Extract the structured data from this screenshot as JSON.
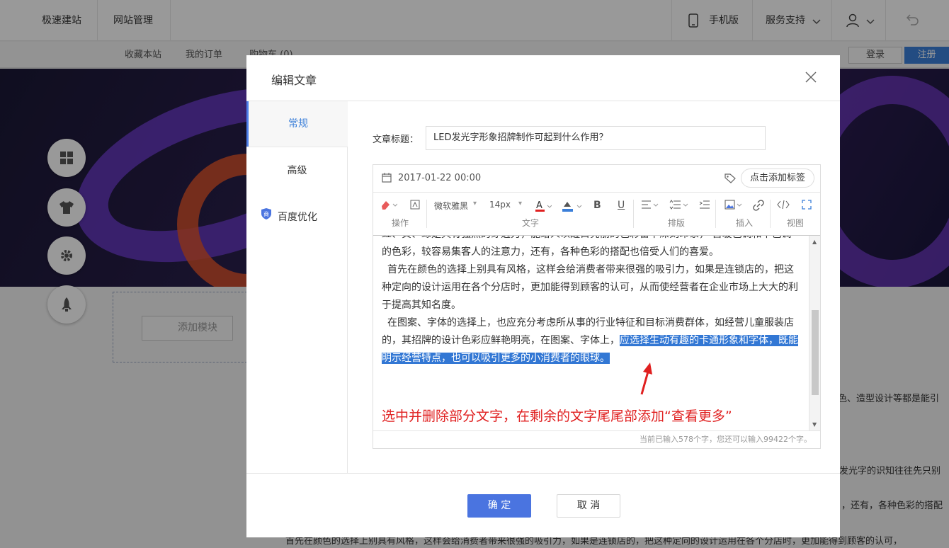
{
  "topbar": {
    "nav1": "极速建站",
    "nav2": "网站管理",
    "mobile": "手机版",
    "support": "服务支持"
  },
  "subbar": {
    "fav": "收藏本站",
    "orders": "我的订单",
    "cart": "购物车 (0)",
    "login": "登录",
    "register": "注册"
  },
  "page": {
    "add_module": "添加模块",
    "bg_line1": "色、造型设计等都是能引",
    "bg_line2": "发光字的识知往往先只别",
    "bg_line3": "，还有，各种色彩的搭配",
    "bg_line4": "首先在颜色的选择上别具有风格，这样会给消费者带来很强的吸引力，如果是连锁店的，把这种定向的设计运用在各个分店时，更加能得到顾客的认可，"
  },
  "modal": {
    "title": "编辑文章",
    "tabs": [
      "常规",
      "高级",
      "百度优化"
    ],
    "field_label": "文章标题：",
    "title_value": "LED发光字形象招牌制作可起到什么作用？",
    "date": "2017-01-22 00:00",
    "tag_button": "点击添加标签",
    "toolbar": {
      "font": "微软雅黑",
      "size": "14px",
      "groups": [
        "操作",
        "文字",
        "排版",
        "插入",
        "视图"
      ]
    },
    "content": {
      "p0": "红、黄、绿是具有强烈的穿透力，能给人以醒目亮丽的色彩留下深刻印象，  营暖色调和中色调的色彩，较容易集客人的注意力，还有，各种色彩的搭配也倍受人们的喜爱。",
      "p1": "首先在颜色的选择上别具有风格，这样会给消费者带来很强的吸引力，如果是连锁店的，把这种定向的设计运用在各个分店时，更加能得到顾客的认可，从而使经营者在企业市场上大大的利于提高其知名度。",
      "p2_plain": "在图案、字体的选择上，也应充分考虑所从事的行业特征和目标消费群体，如经营儿童服装店的，其招牌的设计色彩应鲜艳明亮，在图案、字体上，",
      "p2_selected": "应选择生动有趣的卡通形象和字体，既能明示经营特点，也可以吸引更多的小消费者的眼球。",
      "annotation": "选中并删除部分文字，在剩余的文字尾尾部添加“查看更多”"
    },
    "counter": "当前已输入578个字，您还可以输入99422个字。",
    "ok": "确 定",
    "cancel": "取 消"
  },
  "colors": {
    "accent": "#4a74e0",
    "selection": "#3277d4",
    "annotation": "#e02020"
  }
}
